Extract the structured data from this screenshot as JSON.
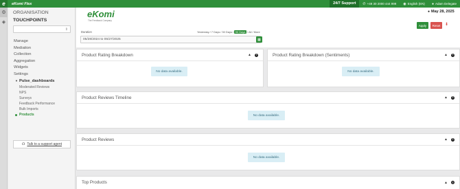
{
  "topbar": {
    "logo_letter": "e",
    "app_title": "eKomi Flex",
    "support": "24/7 Support",
    "phone": "+49 30 2000 444 999",
    "language": "English (EN)",
    "user": "Adam Delegate"
  },
  "sidebar": {
    "organisation": "ORGANISATION",
    "touchpoints": "TOUCHPOINTS",
    "items": [
      "Manage",
      "Mediation",
      "Collection",
      "Aggregation",
      "Widgets",
      "Settings"
    ],
    "group": "Pulse_dashboards",
    "subitems": [
      "Moderated Reviews",
      "NPS",
      "Surveys",
      "Feedback Performance",
      "Bulk Imports"
    ],
    "active_subitem": "Products",
    "help": "Talk to a support agent"
  },
  "header": {
    "logo": "eKomi",
    "tagline": "The Feedback Company",
    "duration_label": "Duration",
    "quick_ranges": [
      "Yesterday",
      "7 Days",
      "30 Days"
    ],
    "quick_selected": "90 Days",
    "quick_rest": [
      "All",
      "More"
    ],
    "date_range": "05/28/2024 to 05/27/2025",
    "today": "May 28, 2025",
    "apply": "Apply",
    "reset": "Reset"
  },
  "cards": {
    "rating": "Product Rating Breakdown",
    "sentiment": "Product Rating Breakdown (Sentiments)",
    "timeline": "Product Reviews Timeline",
    "reviews": "Product Reviews",
    "top": "Top Products",
    "no_data": "No data available."
  },
  "colors": {
    "brand_green": "#2f8f3a",
    "reset_red": "#d9534f",
    "nodata_bg": "#d9eef5"
  }
}
